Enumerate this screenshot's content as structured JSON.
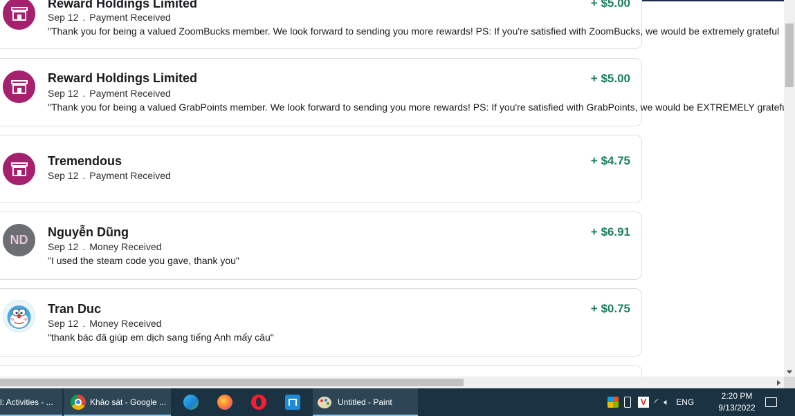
{
  "transactions": [
    {
      "name": "Reward Holdings Limited",
      "date": "Sep 12",
      "type": "Payment Received",
      "amount": "+ $5.00",
      "note": "\"Thank you for being a valued ZoomBucks member. We look forward to sending you more rewards! PS: If you're satisfied with ZoomBucks, we would be extremely grateful",
      "avatar": "store-icon"
    },
    {
      "name": "Reward Holdings Limited",
      "date": "Sep 12",
      "type": "Payment Received",
      "amount": "+ $5.00",
      "note": "\"Thank you for being a valued GrabPoints member. We look forward to sending you more rewards! PS: If you're satisfied with GrabPoints, we would be EXTREMELY grateful",
      "avatar": "store-icon"
    },
    {
      "name": "Tremendous",
      "date": "Sep 12",
      "type": "Payment Received",
      "amount": "+ $4.75",
      "avatar": "store-icon"
    },
    {
      "name": "Nguyễn Dũng",
      "date": "Sep 12",
      "type": "Money Received",
      "amount": "+ $6.91",
      "note": "\"I used the steam code you gave, thank you\"",
      "avatar_initials": "ND"
    },
    {
      "name": "Tran Duc",
      "date": "Sep 12",
      "type": "Money Received",
      "amount": "+ $0.75",
      "note": "\"thank bác đã giúp em dịch sang tiếng Anh mấy câu\"",
      "avatar": "profile-photo"
    }
  ],
  "separator": ".",
  "colors": {
    "amount_positive": "#1a7f5f",
    "store_avatar": "#a6216d",
    "taskbar": "#1b3242"
  },
  "taskbar": {
    "items": [
      {
        "label": "l: Activities - ...",
        "icon": "activities-icon"
      },
      {
        "label": "Khảo sát - Google ...",
        "icon": "chrome-icon"
      },
      {
        "label": "",
        "icon": "edge-icon"
      },
      {
        "label": "",
        "icon": "firefox-icon"
      },
      {
        "label": "",
        "icon": "opera-icon"
      },
      {
        "label": "",
        "icon": "maxthon-icon"
      },
      {
        "label": "Untitled - Paint",
        "icon": "paint-icon"
      }
    ],
    "language": "ENG",
    "time": "2:20 PM",
    "date": "9/13/2022"
  }
}
